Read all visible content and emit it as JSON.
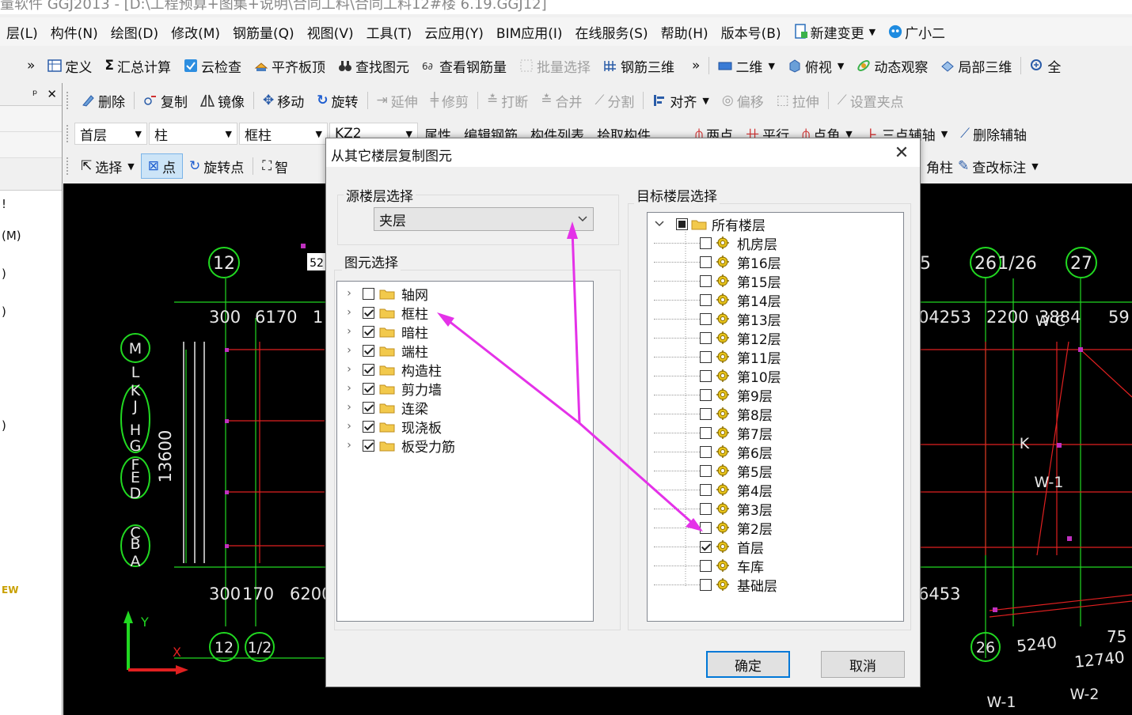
{
  "window": {
    "title": "量软件 GGJ2013 - [D:\\工程预算+图集+说明\\合同工料\\合同工料12#楼 6.19.GGJ12]"
  },
  "menubar": {
    "items": [
      "层(L)",
      "构件(N)",
      "绘图(D)",
      "修改(M)",
      "钢筋量(Q)",
      "视图(V)",
      "工具(T)",
      "云应用(Y)",
      "BIM应用(I)",
      "在线服务(S)",
      "帮助(H)",
      "版本号(B)",
      "新建变更",
      "广小二"
    ]
  },
  "toolbar1": {
    "overflow": "»",
    "items": [
      "定义",
      "汇总计算",
      "云检查",
      "平齐板顶",
      "查找图元",
      "查看钢筋量",
      "批量选择",
      "钢筋三维"
    ],
    "overflow2": "»",
    "view_items": [
      "二维",
      "俯视",
      "动态观察",
      "局部三维"
    ],
    "last": "全"
  },
  "toolbar2": {
    "items": [
      "删除",
      "复制",
      "镜像",
      "移动",
      "旋转",
      "延伸",
      "修剪",
      "打断",
      "合并",
      "分割",
      "对齐",
      "偏移",
      "拉伸",
      "设置夹点"
    ]
  },
  "toolbar3": {
    "floor": "首层",
    "type": "柱",
    "subtype": "框柱",
    "component": "KZ2",
    "items": [
      "属性",
      "编辑钢筋",
      "构件列表",
      "拾取构件"
    ],
    "right_items": [
      "两点",
      "平行",
      "点角",
      "三点辅轴",
      "删除辅轴"
    ]
  },
  "toolbar4": {
    "items": [
      "选择",
      "点",
      "旋转点",
      "智"
    ],
    "right_items": [
      "角柱",
      "查改标注"
    ]
  },
  "left_panel": {
    "pin": "ᵖ",
    "close": "✕",
    "rows": [
      "!",
      "(M)",
      ")",
      ")",
      ")",
      "EW"
    ]
  },
  "canvas": {
    "axis_top": [
      "12",
      "52",
      "5",
      "26",
      "1/26",
      "27"
    ],
    "dims_top": [
      "300",
      "6170",
      "1",
      "04253",
      "2200",
      "3884",
      "59"
    ],
    "row_axes": [
      "M",
      "L",
      "K",
      "J",
      "H",
      "G",
      "F",
      "E",
      "D",
      "C",
      "B",
      "A"
    ],
    "dim_vertical": "13600",
    "dims_bottom": [
      "300",
      "170",
      "6200",
      "6453"
    ],
    "axis_bottom": [
      "12",
      "1/2",
      "26"
    ],
    "dims_br": [
      "5240",
      "12740",
      "75"
    ],
    "walls": [
      "W-C",
      "K",
      "W-1",
      "W-1",
      "W-2"
    ],
    "ucs": {
      "y": "Y",
      "x": "X"
    }
  },
  "dialog": {
    "title": "从其它楼层复制图元",
    "source_group_label": "源楼层选择",
    "source_floor": "夹层",
    "element_group_label": "图元选择",
    "elements": [
      {
        "label": "轴网",
        "checked": false
      },
      {
        "label": "框柱",
        "checked": true
      },
      {
        "label": "暗柱",
        "checked": true
      },
      {
        "label": "端柱",
        "checked": true
      },
      {
        "label": "构造柱",
        "checked": true
      },
      {
        "label": "剪力墙",
        "checked": true
      },
      {
        "label": "连梁",
        "checked": true
      },
      {
        "label": "现浇板",
        "checked": true
      },
      {
        "label": "板受力筋",
        "checked": true
      }
    ],
    "target_group_label": "目标楼层选择",
    "target_root": "所有楼层",
    "floors": [
      {
        "label": "机房层",
        "checked": false
      },
      {
        "label": "第16层",
        "checked": false
      },
      {
        "label": "第15层",
        "checked": false
      },
      {
        "label": "第14层",
        "checked": false
      },
      {
        "label": "第13层",
        "checked": false
      },
      {
        "label": "第12层",
        "checked": false
      },
      {
        "label": "第11层",
        "checked": false
      },
      {
        "label": "第10层",
        "checked": false
      },
      {
        "label": "第9层",
        "checked": false
      },
      {
        "label": "第8层",
        "checked": false
      },
      {
        "label": "第7层",
        "checked": false
      },
      {
        "label": "第6层",
        "checked": false
      },
      {
        "label": "第5层",
        "checked": false
      },
      {
        "label": "第4层",
        "checked": false
      },
      {
        "label": "第3层",
        "checked": false
      },
      {
        "label": "第2层",
        "checked": false
      },
      {
        "label": "首层",
        "checked": true
      },
      {
        "label": "车库",
        "checked": false
      },
      {
        "label": "基础层",
        "checked": false
      }
    ],
    "ok_label": "确定",
    "cancel_label": "取消",
    "close": "✕"
  },
  "colors": {
    "annotation_arrow": "#e432e8",
    "cad_green": "#21d821",
    "cad_red": "#e02020",
    "cad_white": "#e8e8e8"
  }
}
